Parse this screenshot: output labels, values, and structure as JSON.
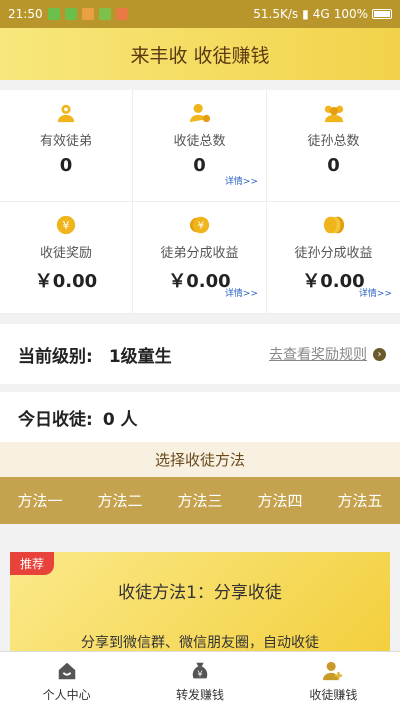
{
  "status_bar": {
    "time": "21:50",
    "speed": "51.5K/s",
    "network": "4G",
    "battery": "100%",
    "app_icons": [
      "wechat-icon",
      "wechat-icon",
      "app-icon",
      "app-icon",
      "app-icon"
    ]
  },
  "header": {
    "title": "来丰收 收徒赚钱"
  },
  "stats": [
    {
      "icon": "medal-person-icon",
      "label": "有效徒弟",
      "value": "0",
      "detail": ""
    },
    {
      "icon": "person-coin-icon",
      "label": "收徒总数",
      "value": "0",
      "detail": "详情>>"
    },
    {
      "icon": "group-icon",
      "label": "徒孙总数",
      "value": "0",
      "detail": ""
    },
    {
      "icon": "yen-coin-icon",
      "label": "收徒奖励",
      "value": "￥0.00",
      "detail": ""
    },
    {
      "icon": "yen-coins-icon",
      "label": "徒弟分成收益",
      "value": "￥0.00",
      "detail": "详情>>"
    },
    {
      "icon": "coin-stack-icon",
      "label": "徒孙分成收益",
      "value": "￥0.00",
      "detail": "详情>>"
    }
  ],
  "level": {
    "label": "当前级别:",
    "value": "1级童生",
    "rule_link": "去查看奖励规则"
  },
  "today": {
    "label": "今日收徒:",
    "value": "0 人"
  },
  "method_section": {
    "title": "选择收徒方法",
    "tabs": [
      "方法一",
      "方法二",
      "方法三",
      "方法四",
      "方法五"
    ]
  },
  "method_card": {
    "badge": "推荐",
    "title": "收徒方法1：分享收徒",
    "desc": "分享到微信群、微信朋友圈，自动收徒"
  },
  "bottom_nav": [
    {
      "icon": "home-icon",
      "label": "个人中心"
    },
    {
      "icon": "money-bag-icon",
      "label": "转发赚钱"
    },
    {
      "icon": "add-user-icon",
      "label": "收徒赚钱"
    }
  ],
  "colors": {
    "accent": "#c4a24e",
    "status_bar": "#b9962b",
    "badge": "#e8433a",
    "link": "#2a63c1"
  }
}
